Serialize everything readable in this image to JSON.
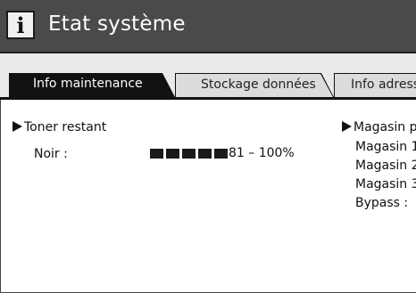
{
  "window": {
    "title": "Etat système",
    "icon": "info-icon",
    "icon_glyph": "i"
  },
  "tabs": [
    {
      "label": "Info maintenance",
      "active": true
    },
    {
      "label": "Stockage données",
      "active": false
    },
    {
      "label": "Info adress",
      "active": false
    }
  ],
  "toner": {
    "title": "Toner restant",
    "items": [
      {
        "label": "Noir :",
        "level_percent": 100,
        "segments_filled": 5,
        "segments_total": 5,
        "value": "81 – 100%"
      }
    ]
  },
  "paper": {
    "title": "Magasin pa",
    "items": [
      {
        "label": "Magasin 1"
      },
      {
        "label": "Magasin 2"
      },
      {
        "label": "Magasin 3"
      },
      {
        "label": "Bypass :"
      }
    ]
  },
  "colors": {
    "titlebar": "#4a4a4a",
    "tab_active": "#111111",
    "tab_inactive": "#dcdcdc",
    "background": "#ffffff"
  }
}
